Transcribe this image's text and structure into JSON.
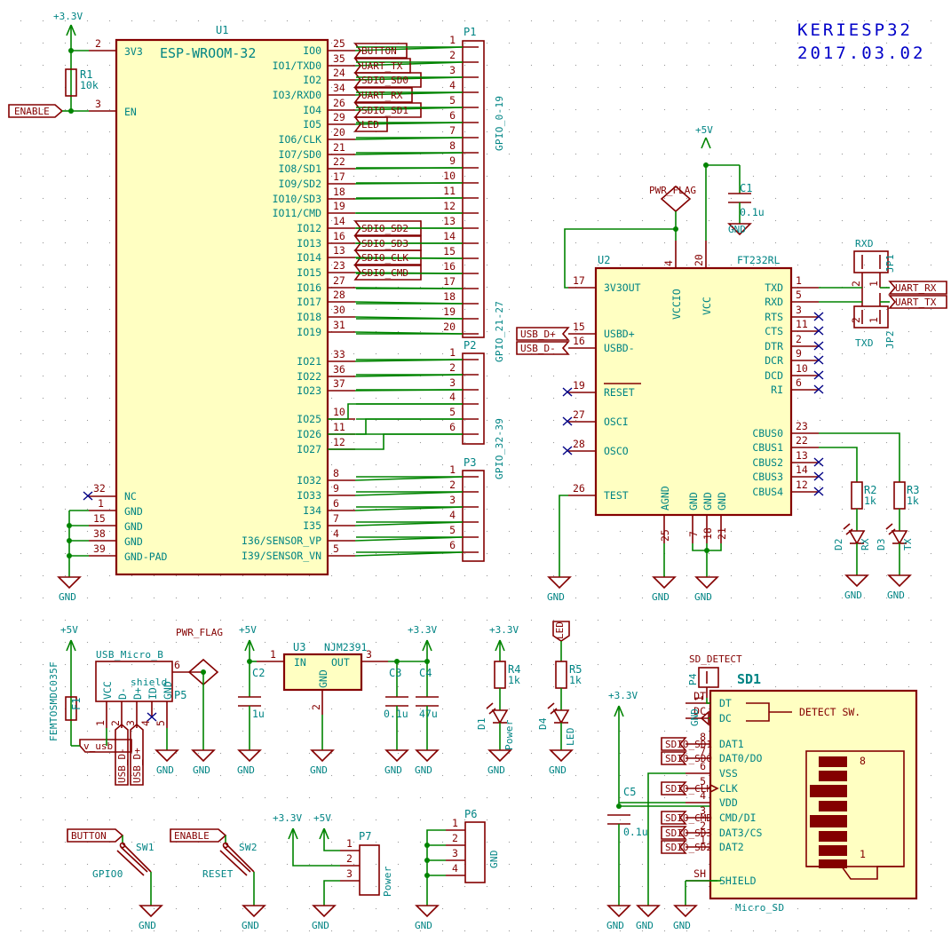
{
  "title_block": {
    "project": "KERIESP32",
    "date": "2017.03.02"
  },
  "u1": {
    "ref": "U1",
    "value": "ESP-WROOM-32",
    "left_pins": [
      {
        "num": "2",
        "name": "3V3"
      },
      {
        "num": "3",
        "name": "EN"
      },
      {
        "num": "32",
        "name": "NC"
      },
      {
        "num": "1",
        "name": "GND"
      },
      {
        "num": "15",
        "name": "GND"
      },
      {
        "num": "38",
        "name": "GND"
      },
      {
        "num": "39",
        "name": "GND-PAD"
      }
    ],
    "right_pins": [
      {
        "num": "25",
        "name": "IO0"
      },
      {
        "num": "35",
        "name": "IO1/TXD0"
      },
      {
        "num": "24",
        "name": "IO2"
      },
      {
        "num": "34",
        "name": "IO3/RXD0"
      },
      {
        "num": "26",
        "name": "IO4"
      },
      {
        "num": "29",
        "name": "IO5"
      },
      {
        "num": "20",
        "name": "IO6/CLK"
      },
      {
        "num": "21",
        "name": "IO7/SD0"
      },
      {
        "num": "22",
        "name": "IO8/SD1"
      },
      {
        "num": "17",
        "name": "IO9/SD2"
      },
      {
        "num": "18",
        "name": "IO10/SD3"
      },
      {
        "num": "19",
        "name": "IO11/CMD"
      },
      {
        "num": "14",
        "name": "IO12"
      },
      {
        "num": "16",
        "name": "IO13"
      },
      {
        "num": "13",
        "name": "IO14"
      },
      {
        "num": "23",
        "name": "IO15"
      },
      {
        "num": "27",
        "name": "IO16"
      },
      {
        "num": "28",
        "name": "IO17"
      },
      {
        "num": "30",
        "name": "IO18"
      },
      {
        "num": "31",
        "name": "IO19"
      },
      {
        "num": "33",
        "name": "IO21"
      },
      {
        "num": "36",
        "name": "IO22"
      },
      {
        "num": "37",
        "name": "IO23"
      },
      {
        "num": "10",
        "name": "IO25"
      },
      {
        "num": "11",
        "name": "IO26"
      },
      {
        "num": "12",
        "name": "IO27"
      },
      {
        "num": "8",
        "name": "IO32"
      },
      {
        "num": "9",
        "name": "IO33"
      },
      {
        "num": "6",
        "name": "I34"
      },
      {
        "num": "7",
        "name": "I35"
      },
      {
        "num": "4",
        "name": "I36/SENSOR_VP"
      },
      {
        "num": "5",
        "name": "I39/SENSOR_VN"
      }
    ],
    "net_labels": [
      "BUTTON",
      "UART_TX",
      "SDIO_SD0",
      "UART_RX",
      "SDIO_SD1",
      "LED",
      "SDIO_SD2",
      "SDIO_SD3",
      "SDIO_CLK",
      "SDIO_CMD"
    ]
  },
  "u2": {
    "ref": "U2",
    "value": "FT232RL",
    "left_pins": [
      {
        "num": "17",
        "name": "3V3OUT"
      },
      {
        "num": "15",
        "name": "USBD+"
      },
      {
        "num": "16",
        "name": "USBD-"
      },
      {
        "num": "19",
        "name": "RESET"
      },
      {
        "num": "27",
        "name": "OSCI"
      },
      {
        "num": "28",
        "name": "OSCO"
      },
      {
        "num": "26",
        "name": "TEST"
      }
    ],
    "top_pins": [
      {
        "num": "4",
        "name": "VCCIO"
      },
      {
        "num": "20",
        "name": "VCC"
      }
    ],
    "right_pins": [
      {
        "num": "1",
        "name": "TXD"
      },
      {
        "num": "5",
        "name": "RXD"
      },
      {
        "num": "3",
        "name": "RTS"
      },
      {
        "num": "11",
        "name": "CTS"
      },
      {
        "num": "2",
        "name": "DTR"
      },
      {
        "num": "9",
        "name": "DCR"
      },
      {
        "num": "10",
        "name": "DCD"
      },
      {
        "num": "6",
        "name": "RI"
      },
      {
        "num": "23",
        "name": "CBUS0"
      },
      {
        "num": "22",
        "name": "CBUS1"
      },
      {
        "num": "13",
        "name": "CBUS2"
      },
      {
        "num": "14",
        "name": "CBUS3"
      },
      {
        "num": "12",
        "name": "CBUS4"
      }
    ],
    "bottom_pins": [
      {
        "num": "25",
        "name": "AGND"
      },
      {
        "num": "7",
        "name": "GND"
      },
      {
        "num": "18",
        "name": "GND"
      },
      {
        "num": "21",
        "name": "GND"
      }
    ],
    "net_labels": [
      "USB_D+",
      "USB_D-",
      "UART_RX",
      "UART_TX"
    ]
  },
  "u3": {
    "ref": "U3",
    "value": "NJM2391",
    "pins": [
      {
        "num": "1",
        "name": "IN"
      },
      {
        "num": "3",
        "name": "OUT"
      },
      {
        "num": "2",
        "name": "GND"
      }
    ]
  },
  "sd1": {
    "ref": "SD1",
    "value": "Micro_SD",
    "detect_label": "DETECT SW.",
    "pins": [
      {
        "num": "DT",
        "name": "DT"
      },
      {
        "num": "DC",
        "name": "DC"
      },
      {
        "num": "8",
        "name": "DAT1"
      },
      {
        "num": "7",
        "name": "DAT0/DO"
      },
      {
        "num": "6",
        "name": "VSS"
      },
      {
        "num": "5",
        "name": "CLK"
      },
      {
        "num": "4",
        "name": "VDD"
      },
      {
        "num": "3",
        "name": "CMD/DI"
      },
      {
        "num": "2",
        "name": "DAT3/CS"
      },
      {
        "num": "1",
        "name": "DAT2"
      },
      {
        "num": "SH",
        "name": "SHIELD"
      }
    ],
    "card_pin_top": "8",
    "card_pin_bottom": "1",
    "net_labels": [
      "SDIO_SD1",
      "SDIO_SD0",
      "SDIO_CLK",
      "SDIO_CMD",
      "SDIO_SD3",
      "SDIO_SD2"
    ]
  },
  "connectors": {
    "p1": {
      "ref": "P1",
      "value": "GPIO_0-19",
      "pins": [
        "1",
        "2",
        "3",
        "4",
        "5",
        "6",
        "7",
        "8",
        "9",
        "10",
        "11",
        "12",
        "13",
        "14",
        "15",
        "16",
        "17",
        "18",
        "19",
        "20"
      ]
    },
    "p2": {
      "ref": "P2",
      "value": "GPIO_21-27",
      "pins": [
        "1",
        "2",
        "3",
        "4",
        "5",
        "6"
      ]
    },
    "p3": {
      "ref": "P3",
      "value": "GPIO_32-39",
      "pins": [
        "1",
        "2",
        "3",
        "4",
        "5",
        "6"
      ]
    },
    "p4": {
      "ref": "P4",
      "value": "SD_DETECT",
      "pins": [
        "1"
      ]
    },
    "p5": {
      "ref": "P5",
      "value": "USB_Micro_B",
      "shield_label": "shield",
      "shield_num": "6",
      "pins": [
        {
          "num": "1",
          "name": "VCC"
        },
        {
          "num": "2",
          "name": "D-"
        },
        {
          "num": "3",
          "name": "D+"
        },
        {
          "num": "4",
          "name": "ID"
        },
        {
          "num": "5",
          "name": "GND"
        }
      ],
      "net_labels": [
        "USB_D-",
        "USB_D+"
      ]
    },
    "p6": {
      "ref": "P6",
      "value": "GND",
      "pins": [
        "1",
        "2",
        "3",
        "4"
      ]
    },
    "p7": {
      "ref": "P7",
      "value": "Power",
      "pins": [
        "1",
        "2",
        "3"
      ]
    },
    "jp1": {
      "ref": "JP1",
      "value": "RXD",
      "pins": [
        "2",
        "1"
      ]
    },
    "jp2": {
      "ref": "JP2",
      "value": "TXD",
      "pins": [
        "2",
        "1"
      ]
    }
  },
  "passives": [
    {
      "ref": "R1",
      "value": "10k"
    },
    {
      "ref": "R2",
      "value": "1k"
    },
    {
      "ref": "R3",
      "value": "1k"
    },
    {
      "ref": "R4",
      "value": "1k"
    },
    {
      "ref": "R5",
      "value": "1k"
    },
    {
      "ref": "C1",
      "value": "0.1u"
    },
    {
      "ref": "C2",
      "value": "1u"
    },
    {
      "ref": "C3",
      "value": "0.1u"
    },
    {
      "ref": "C4",
      "value": "47u"
    },
    {
      "ref": "C5",
      "value": "0.1u"
    },
    {
      "ref": "D1",
      "value": "Power"
    },
    {
      "ref": "D2",
      "value": "RX"
    },
    {
      "ref": "D3",
      "value": "TX"
    },
    {
      "ref": "D4",
      "value": "LED"
    },
    {
      "ref": "F1",
      "value": "FEMTOSMDC035F"
    },
    {
      "ref": "SW1",
      "value": "GPIO0"
    },
    {
      "ref": "SW2",
      "value": "RESET"
    }
  ],
  "power_labels": {
    "v33": "+3.3V",
    "v5": "+5V",
    "gnd": "GND",
    "pwr_flag": "PWR_FLAG",
    "v_usb": "v_usb"
  },
  "global_labels": {
    "enable": "ENABLE",
    "button": "BUTTON",
    "led": "LED",
    "sd_detect": "SD_DETECT"
  },
  "colors": {
    "body_fill": "#ffffc2",
    "outline": "#840000",
    "wire": "#008400",
    "pin_name": "#008484",
    "pin_num": "#840000",
    "title": "#0000c8",
    "background": "#ffffff"
  }
}
